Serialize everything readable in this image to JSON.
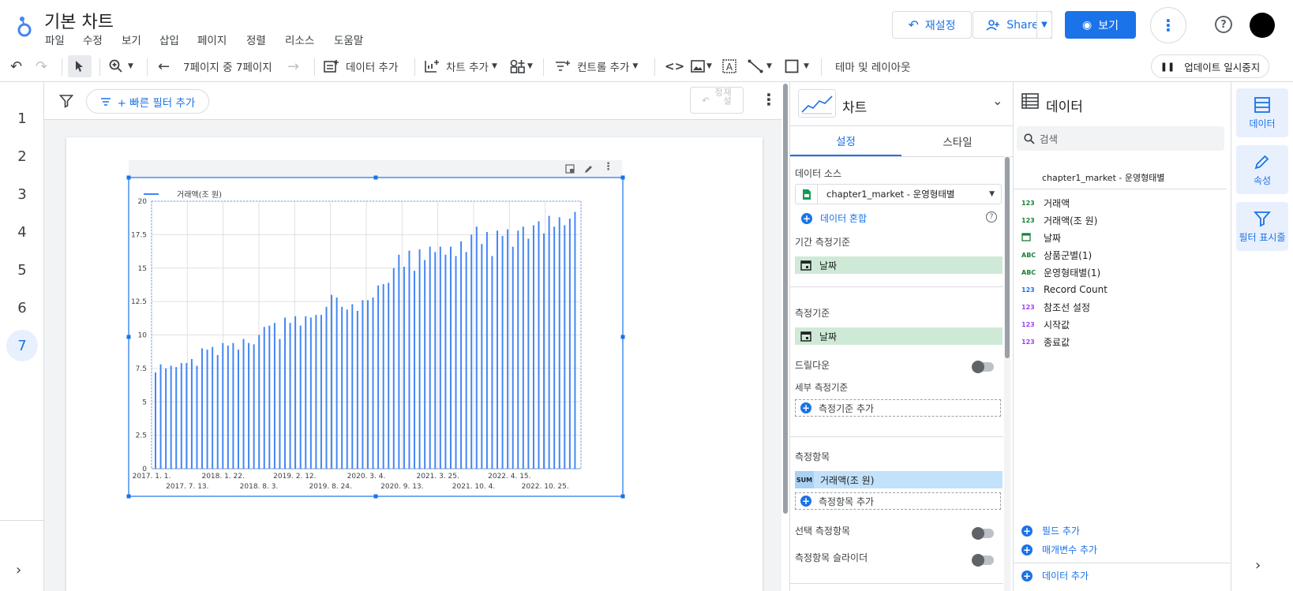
{
  "app": {
    "title": "기본 차트",
    "menu": [
      "파일",
      "수정",
      "보기",
      "삽입",
      "페이지",
      "정렬",
      "리소스",
      "도움말"
    ],
    "reset_label": "재설정",
    "share_label": "Share",
    "view_label": "보기"
  },
  "toolbar": {
    "page_indicator": "7페이지 중 7페이지",
    "add_data": "데이터 추가",
    "add_chart": "차트 추가",
    "add_control": "컨트롤 추가",
    "theme_layout": "테마 및 레이아웃",
    "pause_updates": "업데이트 일시중지"
  },
  "pages": [
    "1",
    "2",
    "3",
    "4",
    "5",
    "6",
    "7"
  ],
  "current_page": "7",
  "filterbar": {
    "quick_filter": "+ 빠른 필터 추가",
    "reset": "재설정"
  },
  "chart_data": {
    "type": "bar",
    "legend": "거래액(조 원)",
    "legend_position": "top-left",
    "ylim": [
      0,
      20
    ],
    "yticks": [
      "0",
      "2.5",
      "5",
      "7.5",
      "10",
      "12.5",
      "15",
      "17.5",
      "20"
    ],
    "xticks_top": [
      "2017. 1. 1.",
      "2018. 1. 22.",
      "2019. 2. 12.",
      "2020. 3. 4.",
      "2021. 3. 25.",
      "2022. 4. 15."
    ],
    "xticks_bottom": [
      "2017. 7. 13.",
      "2018. 8. 3.",
      "2019. 8. 24.",
      "2020. 9. 13.",
      "2021. 10. 4.",
      "2022. 10. 25."
    ],
    "grid": true,
    "color": "#4285f4",
    "values": [
      7.2,
      7.8,
      7.5,
      7.7,
      7.6,
      7.9,
      7.9,
      8.2,
      7.7,
      9.0,
      8.9,
      9.1,
      8.5,
      9.4,
      9.2,
      9.4,
      8.9,
      9.7,
      9.4,
      9.3,
      10.0,
      10.6,
      10.7,
      10.9,
      9.7,
      11.3,
      10.9,
      11.4,
      10.7,
      11.4,
      11.3,
      11.5,
      11.5,
      12.1,
      13.0,
      12.8,
      12.1,
      11.9,
      12.3,
      11.8,
      12.6,
      12.6,
      12.8,
      13.7,
      13.8,
      13.9,
      15.0,
      16.0,
      15.1,
      16.3,
      14.8,
      16.4,
      15.6,
      16.6,
      16.2,
      16.6,
      16.0,
      16.6,
      15.9,
      17.0,
      16.2,
      17.5,
      18.1,
      16.8,
      17.7,
      15.9,
      17.8,
      17.4,
      17.9,
      16.6,
      17.8,
      18.1,
      17.2,
      18.2,
      18.5,
      17.6,
      18.9,
      18.1,
      18.8,
      18.2,
      18.7,
      19.2
    ]
  },
  "props": {
    "header": "차트",
    "tab_setup": "설정",
    "tab_style": "스타일",
    "datasource_label": "데이터 소스",
    "datasource_value": "chapter1_market - 운영형태별",
    "blend_label": "데이터 혼합",
    "date_range_dim_label": "기간 측정기준",
    "date_range_dim_value": "날짜",
    "dimension_label": "측정기준",
    "dimension_value": "날짜",
    "drilldown_label": "드릴다운",
    "breakdown_label": "세부 측정기준",
    "add_dimension": "측정기준 추가",
    "metric_label": "측정항목",
    "metric_agg": "SUM",
    "metric_value": "거래액(조 원)",
    "add_metric": "측정항목 추가",
    "optional_metrics": "선택 측정항목",
    "metric_slider": "측정항목 슬라이더"
  },
  "datapanel": {
    "header": "데이터",
    "search_placeholder": "검색",
    "source_name": "chapter1_market - 운영형태별",
    "fields": [
      {
        "type": "123",
        "name": "거래액"
      },
      {
        "type": "123",
        "name": "거래액(조 원)"
      },
      {
        "type": "date",
        "name": "날짜"
      },
      {
        "type": "ABC",
        "name": "상품군별(1)"
      },
      {
        "type": "ABC",
        "name": "운영형태별(1)"
      },
      {
        "type": "123",
        "name": "Record Count"
      },
      {
        "type": "123",
        "name": "참조선 설정"
      },
      {
        "type": "123",
        "name": "시작값"
      },
      {
        "type": "123",
        "name": "종료값"
      }
    ],
    "add_field": "필드 추가",
    "add_param": "매개변수 추가",
    "add_data": "데이터 추가"
  },
  "rail": {
    "data": "데이터",
    "properties": "속성",
    "filter": "필터 표시줄"
  }
}
